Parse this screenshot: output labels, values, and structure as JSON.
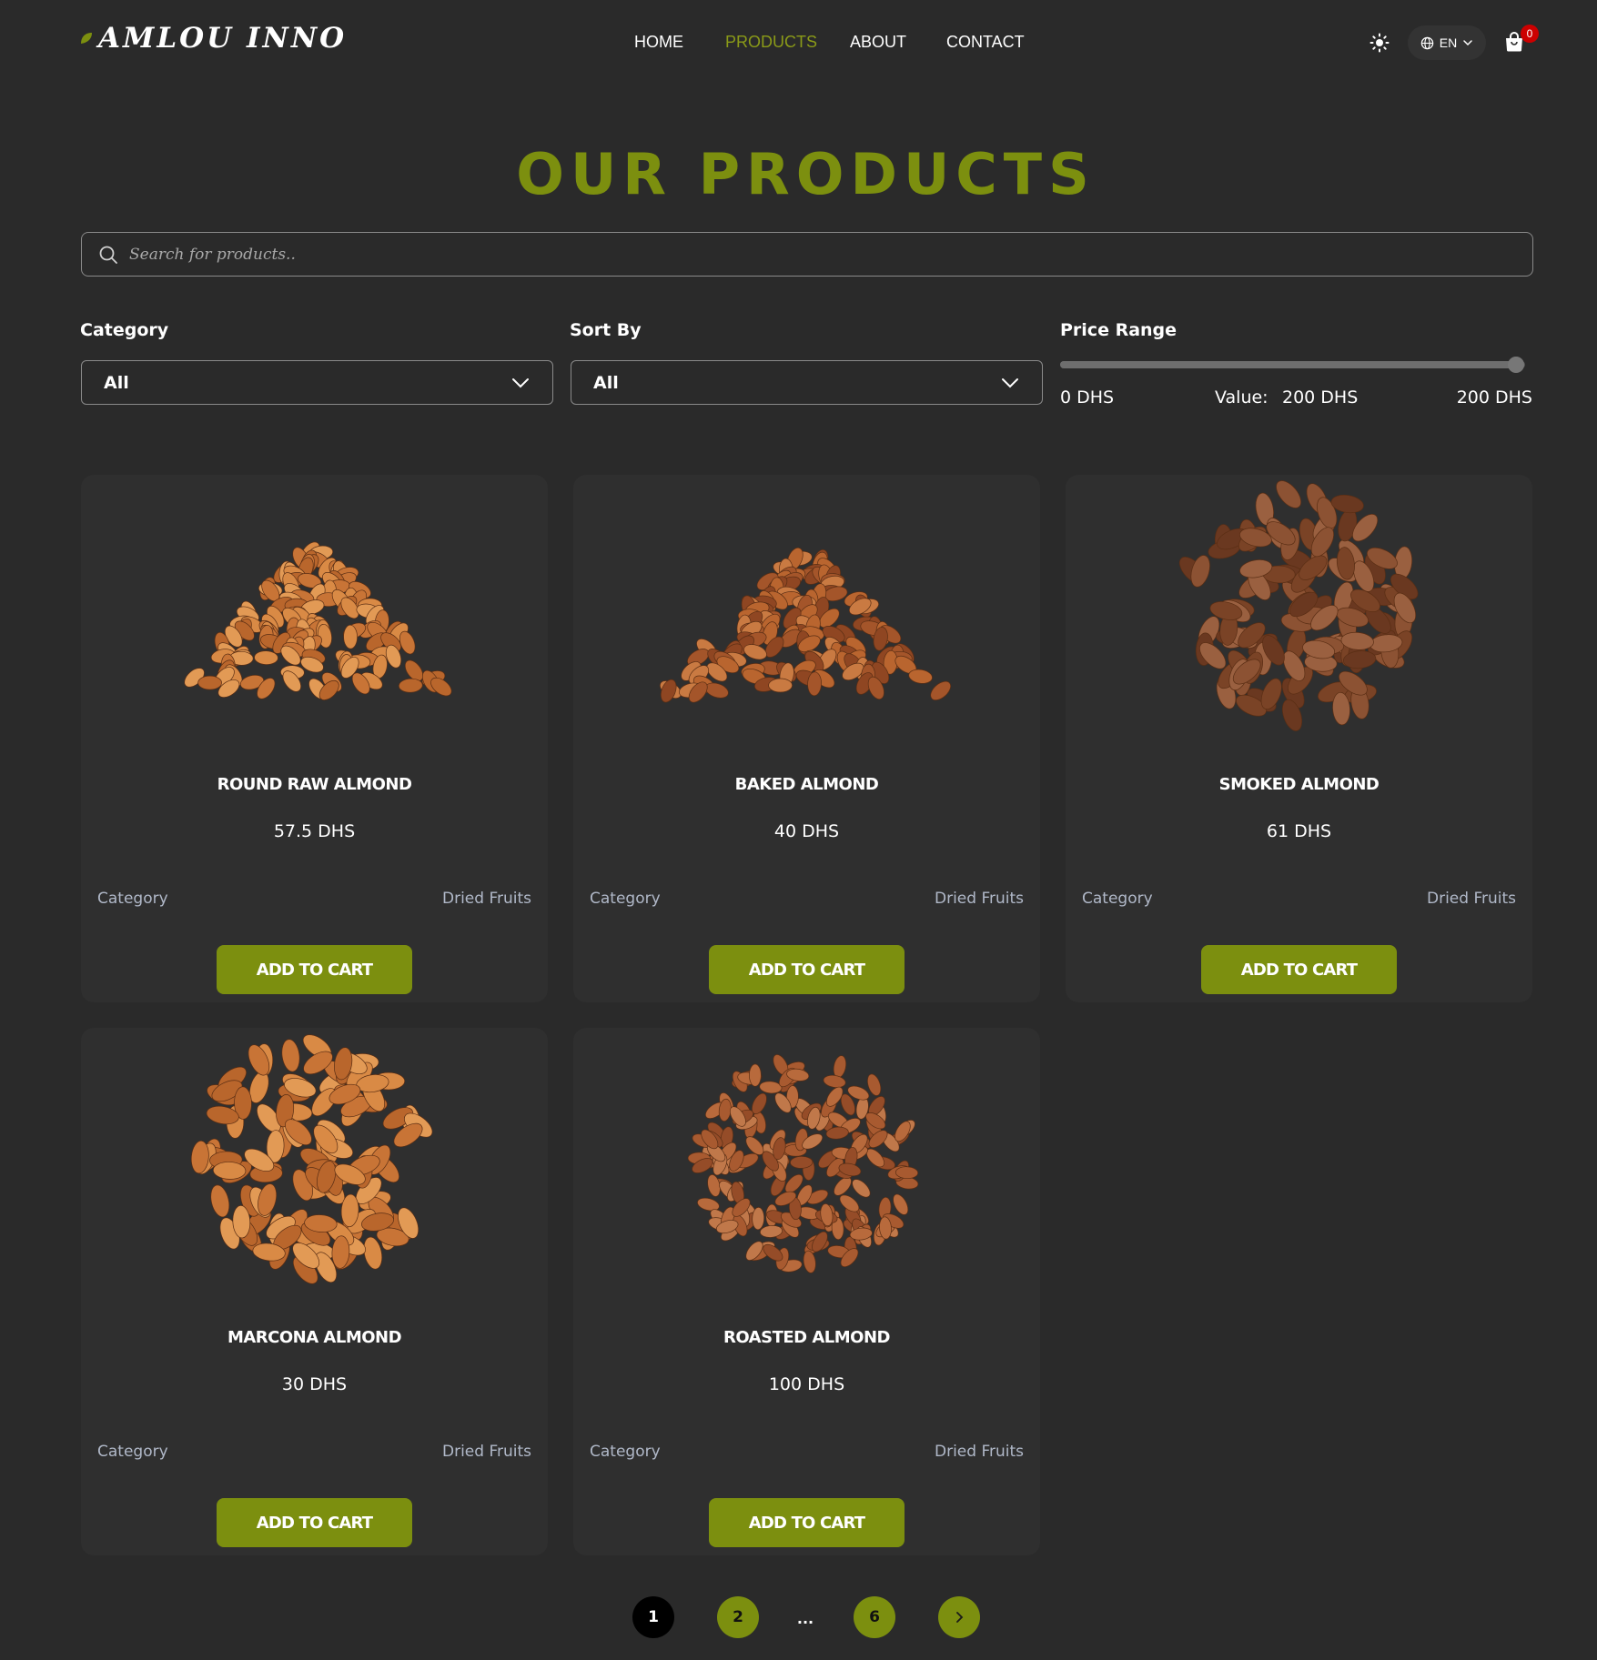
{
  "brand": {
    "name": "AMLOU INNO"
  },
  "nav": {
    "items": [
      {
        "label": "HOME",
        "active": false
      },
      {
        "label": "PRODUCTS",
        "active": true
      },
      {
        "label": "ABOUT",
        "active": false
      },
      {
        "label": "CONTACT",
        "active": false
      }
    ]
  },
  "header": {
    "language": "EN",
    "cart_count": "0",
    "icons": [
      "sun-icon",
      "globe-icon",
      "chevron-down-icon",
      "shopping-bag-icon"
    ]
  },
  "page_title": "OUR PRODUCTS",
  "search": {
    "placeholder": "Search for products..",
    "value": ""
  },
  "filters": {
    "category": {
      "label": "Category",
      "value": "All"
    },
    "sort_by": {
      "label": "Sort By",
      "value": "All"
    },
    "price_range": {
      "label": "Price Range",
      "min_text": "0 DHS",
      "max_text": "200 DHS",
      "value_label": "Value:",
      "value_text": "200 DHS",
      "min": 0,
      "max": 200,
      "value": 200
    }
  },
  "products": [
    {
      "name": "ROUND RAW ALMOND",
      "price": "57.5 DHS",
      "category_label": "Category",
      "category": "Dried Fruits",
      "button": "ADD TO CART",
      "image": "almond-pile-light"
    },
    {
      "name": "BAKED ALMOND",
      "price": "40 DHS",
      "category_label": "Category",
      "category": "Dried Fruits",
      "button": "ADD TO CART",
      "image": "almond-pile-baked"
    },
    {
      "name": "SMOKED ALMOND",
      "price": "61 DHS",
      "category_label": "Category",
      "category": "Dried Fruits",
      "button": "ADD TO CART",
      "image": "almond-round-smoked"
    },
    {
      "name": "MARCONA ALMOND",
      "price": "30 DHS",
      "category_label": "Category",
      "category": "Dried Fruits",
      "button": "ADD TO CART",
      "image": "almond-round-light"
    },
    {
      "name": "ROASTED ALMOND",
      "price": "100 DHS",
      "category_label": "Category",
      "category": "Dried Fruits",
      "button": "ADD TO CART",
      "image": "almond-round-roasted"
    }
  ],
  "pagination": {
    "pages": [
      "1",
      "2",
      "6"
    ],
    "ellipsis": "...",
    "current": "1",
    "next_icon": "chevron-right-icon"
  },
  "colors": {
    "accent": "#7c8f0f",
    "background": "#2a2a2a",
    "card": "#2f2f2f",
    "badge": "#cc0000"
  }
}
